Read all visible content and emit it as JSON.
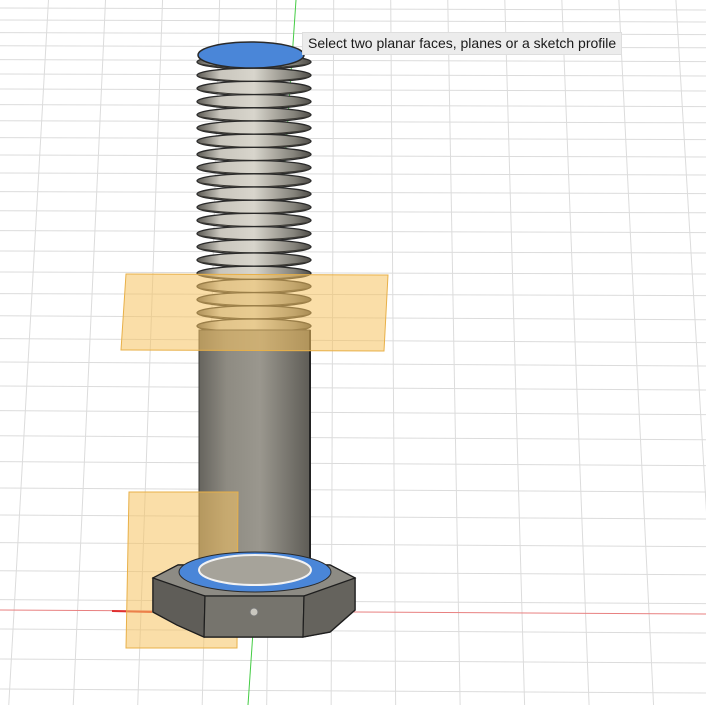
{
  "viewport": {
    "tooltip": {
      "text": "Select two planar faces, planes or a sketch profile"
    }
  },
  "colors": {
    "background": "#ffffff",
    "grid_line": "#dcdcdc",
    "axis_x": "#e03030",
    "axis_y": "#22bb22",
    "axis_z": "#3344cc",
    "selection_face": "#4a86d8",
    "offset_plane": "#f5c260",
    "bolt_metal": "#8c8a82",
    "hex_head": "#6e6c66"
  },
  "icons": [
    "selected-face-highlight",
    "offset-plane",
    "hex-bolt-model",
    "origin-point"
  ]
}
